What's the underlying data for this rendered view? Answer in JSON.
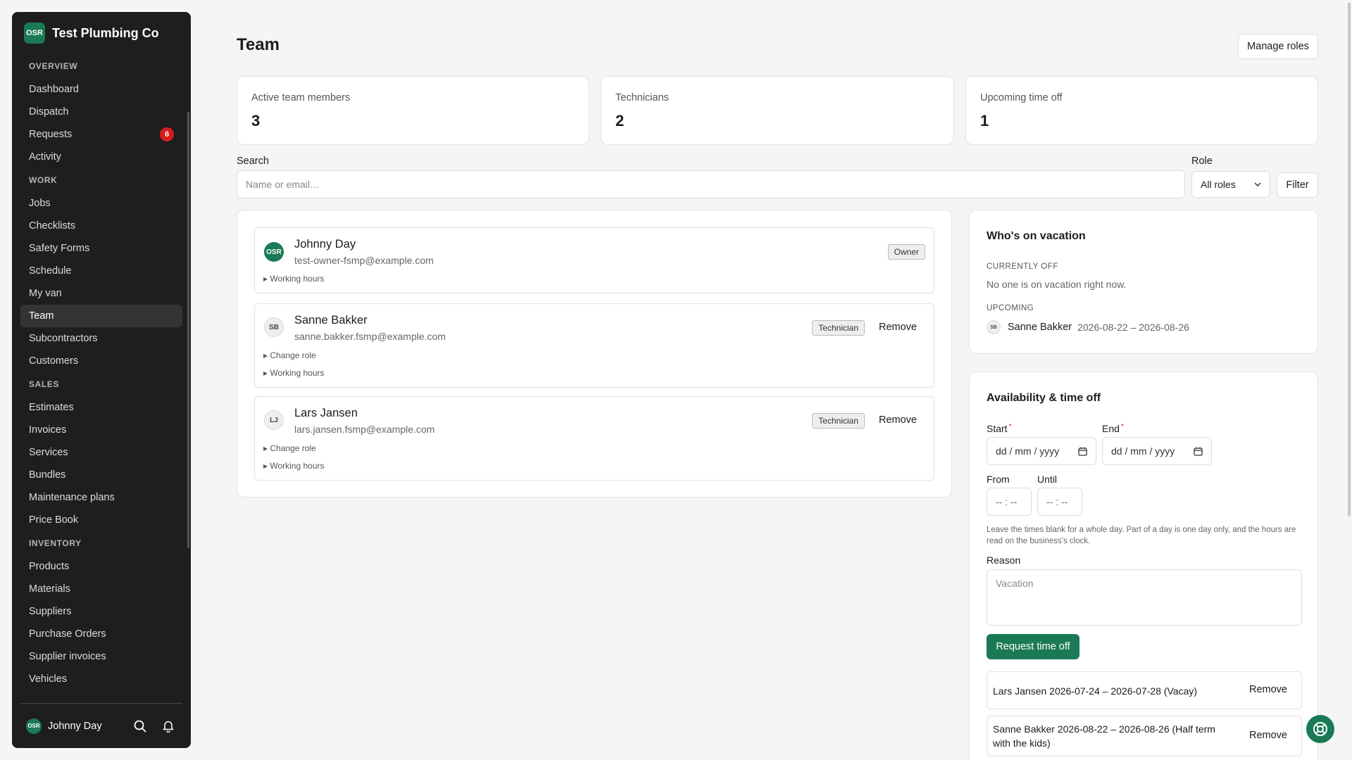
{
  "sidebar": {
    "org_name": "Test Plumbing Co",
    "logo_text": "OSR",
    "sections": [
      {
        "title": "OVERVIEW",
        "items": [
          {
            "label": "Dashboard"
          },
          {
            "label": "Dispatch"
          },
          {
            "label": "Requests",
            "badge": "6"
          },
          {
            "label": "Activity"
          }
        ]
      },
      {
        "title": "WORK",
        "items": [
          {
            "label": "Jobs"
          },
          {
            "label": "Checklists"
          },
          {
            "label": "Safety Forms"
          },
          {
            "label": "Schedule"
          },
          {
            "label": "My van"
          },
          {
            "label": "Team",
            "active": true
          },
          {
            "label": "Subcontractors"
          },
          {
            "label": "Customers"
          }
        ]
      },
      {
        "title": "SALES",
        "items": [
          {
            "label": "Estimates"
          },
          {
            "label": "Invoices"
          },
          {
            "label": "Services"
          },
          {
            "label": "Bundles"
          },
          {
            "label": "Maintenance plans"
          },
          {
            "label": "Price Book"
          }
        ]
      },
      {
        "title": "INVENTORY",
        "items": [
          {
            "label": "Products"
          },
          {
            "label": "Materials"
          },
          {
            "label": "Suppliers"
          },
          {
            "label": "Purchase Orders"
          },
          {
            "label": "Supplier invoices"
          },
          {
            "label": "Vehicles"
          }
        ]
      }
    ],
    "footer": {
      "avatar": "OSR",
      "user_name": "Johnny Day"
    }
  },
  "header": {
    "title": "Team",
    "manage_roles": "Manage roles"
  },
  "stats": [
    {
      "label": "Active team members",
      "value": "3"
    },
    {
      "label": "Technicians",
      "value": "2"
    },
    {
      "label": "Upcoming time off",
      "value": "1"
    }
  ],
  "search": {
    "label": "Search",
    "placeholder": "Name or email…",
    "role_label": "Role",
    "role_value": "All roles",
    "filter": "Filter"
  },
  "members": [
    {
      "initials": "OSR",
      "name": "Johnny Day",
      "email": "test-owner-fsmp@example.com",
      "role": "Owner",
      "toggles": [
        "Working hours"
      ]
    },
    {
      "initials": "SB",
      "name": "Sanne Bakker",
      "email": "sanne.bakker.fsmp@example.com",
      "role": "Technician",
      "remove": "Remove",
      "toggles": [
        "Change role",
        "Working hours"
      ]
    },
    {
      "initials": "LJ",
      "name": "Lars Jansen",
      "email": "lars.jansen.fsmp@example.com",
      "role": "Technician",
      "remove": "Remove",
      "toggles": [
        "Change role",
        "Working hours"
      ]
    }
  ],
  "vacation": {
    "title": "Who's on vacation",
    "currently_off_label": "CURRENTLY OFF",
    "currently_off_text": "No one is on vacation right now.",
    "upcoming_label": "UPCOMING",
    "upcoming": [
      {
        "initials": "SB",
        "name": "Sanne Bakker",
        "dates": "2026-08-22 – 2026-08-26"
      }
    ]
  },
  "availability": {
    "title": "Availability & time off",
    "start_label": "Start",
    "end_label": "End",
    "date_placeholder": "dd / mm / yyyy",
    "from_label": "From",
    "until_label": "Until",
    "time_placeholder": "-- : --",
    "help": "Leave the times blank for a whole day. Part of a day is one day only, and the hours are read on the business's clock.",
    "reason_label": "Reason",
    "reason_placeholder": "Vacation",
    "submit": "Request time off",
    "entries": [
      {
        "text": "Lars Jansen 2026-07-24 – 2026-07-28 (Vacay)",
        "remove": "Remove"
      },
      {
        "text": "Sanne Bakker 2026-08-22 – 2026-08-26 (Half term with the kids)",
        "remove": "Remove"
      }
    ]
  },
  "colors": {
    "brand": "#1a7a55",
    "badge": "#d81b1b",
    "sidebar_bg": "#1e1e1e"
  }
}
